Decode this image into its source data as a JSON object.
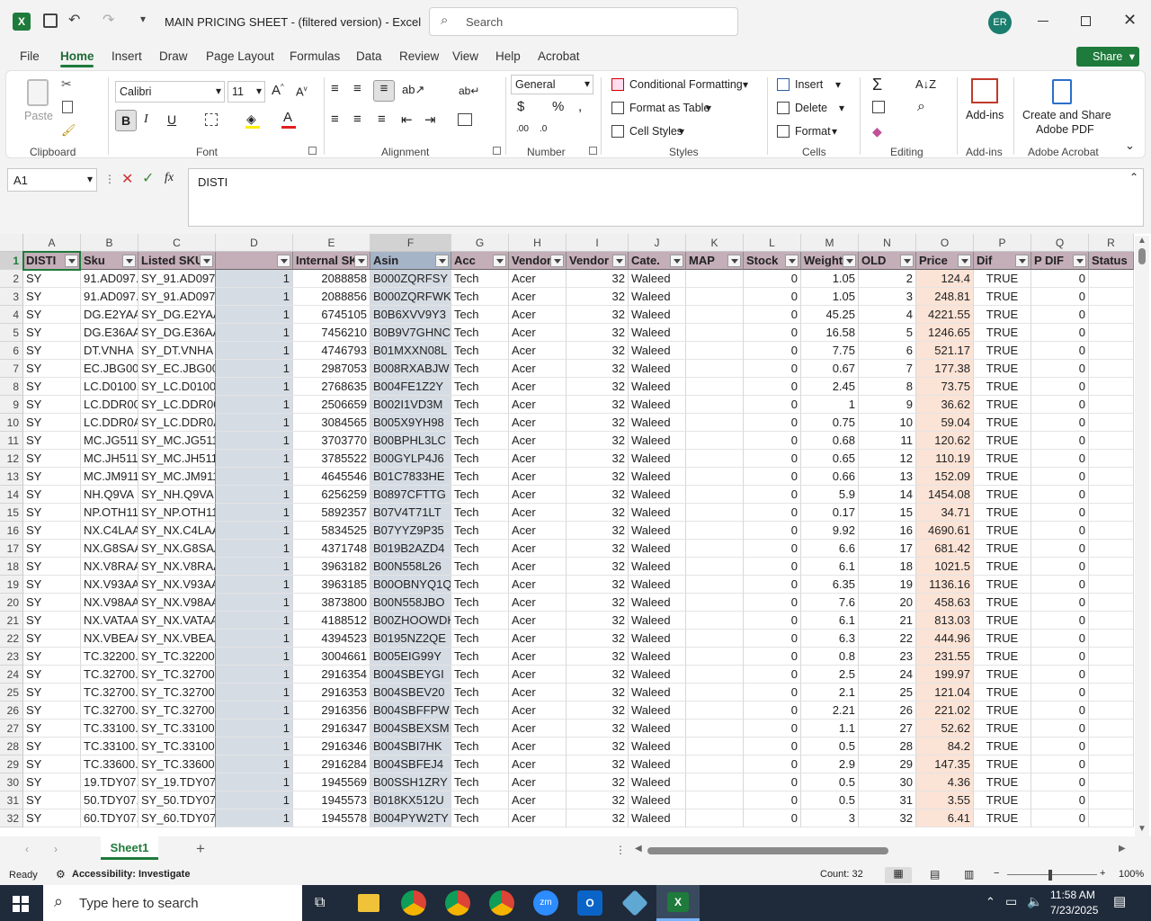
{
  "window": {
    "title": "MAIN PRICING SHEET - (filtered version)  -  Excel",
    "search_placeholder": "Search",
    "user_initials": "ER"
  },
  "ribbon_tabs": [
    "File",
    "Home",
    "Insert",
    "Draw",
    "Page Layout",
    "Formulas",
    "Data",
    "Review",
    "View",
    "Help",
    "Acrobat"
  ],
  "share_label": "Share",
  "ribbon": {
    "paste": "Paste",
    "font_name": "Calibri",
    "font_size": "11",
    "number_format": "General",
    "cond_format": "Conditional Formatting",
    "format_table": "Format as Table",
    "cell_styles": "Cell Styles",
    "insert": "Insert",
    "delete": "Delete",
    "format": "Format",
    "addins": "Add-ins",
    "create_share_1": "Create and Share",
    "create_share_2": "Adobe PDF",
    "groups": {
      "clipboard": "Clipboard",
      "font": "Font",
      "alignment": "Alignment",
      "number": "Number",
      "styles": "Styles",
      "cells": "Cells",
      "editing": "Editing",
      "addins": "Add-ins",
      "acrobat": "Adobe Acrobat"
    }
  },
  "formula_bar": {
    "name_box": "A1",
    "fx": "fx",
    "content": "DISTI"
  },
  "columns": [
    "A",
    "B",
    "C",
    "D",
    "E",
    "F",
    "G",
    "H",
    "I",
    "J",
    "K",
    "L",
    "M",
    "N",
    "O",
    "P",
    "Q",
    "R"
  ],
  "headers": [
    "DISTI",
    "Sku",
    "Listed SKU",
    "",
    "Internal SK",
    "Asin",
    "Acc",
    "Vendor",
    "Vendor",
    "Cate.",
    "MAP",
    "Stock",
    "Weight",
    "OLD",
    "Price",
    "Dif",
    "P DIF",
    "Status"
  ],
  "rows": [
    {
      "n": "2",
      "b": "91.AD097.",
      "c": "SY_91.AD097.",
      "e": "2088858",
      "f": "B000ZQRFSY",
      "m": "1.05",
      "o": "124.4"
    },
    {
      "n": "3",
      "b": "91.AD097.",
      "c": "SY_91.AD097.",
      "e": "2088856",
      "f": "B000ZQRFWK",
      "m": "1.05",
      "o": "248.81"
    },
    {
      "n": "4",
      "b": "DG.E2YAA",
      "c": "SY_DG.E2YAA",
      "e": "6745105",
      "f": "B0B6XVV9Y3",
      "m": "45.25",
      "o": "4221.55"
    },
    {
      "n": "5",
      "b": "DG.E36AA",
      "c": "SY_DG.E36AA",
      "e": "7456210",
      "f": "B0B9V7GHNC",
      "m": "16.58",
      "o": "1246.65"
    },
    {
      "n": "6",
      "b": "DT.VNHA",
      "c": "SY_DT.VNHA",
      "e": "4746793",
      "f": "B01MXXN08L",
      "m": "7.75",
      "o": "521.17"
    },
    {
      "n": "7",
      "b": "EC.JBG00.",
      "c": "SY_EC.JBG00.",
      "e": "2987053",
      "f": "B008RXABJW",
      "m": "0.67",
      "o": "177.38"
    },
    {
      "n": "8",
      "b": "LC.D0100.",
      "c": "SY_LC.D0100.",
      "e": "2768635",
      "f": "B004FE1Z2Y",
      "m": "2.45",
      "o": "73.75"
    },
    {
      "n": "9",
      "b": "LC.DDR00.",
      "c": "SY_LC.DDR00.",
      "e": "2506659",
      "f": "B002I1VD3M",
      "m": "1",
      "o": "36.62"
    },
    {
      "n": "10",
      "b": "LC.DDR0A",
      "c": "SY_LC.DDR0A",
      "e": "3084565",
      "f": "B005X9YH98",
      "m": "0.75",
      "o": "59.04"
    },
    {
      "n": "11",
      "b": "MC.JG511",
      "c": "SY_MC.JG511.",
      "e": "3703770",
      "f": "B00BPHL3LC",
      "m": "0.68",
      "o": "120.62"
    },
    {
      "n": "12",
      "b": "MC.JH511",
      "c": "SY_MC.JH511.",
      "e": "3785522",
      "f": "B00GYLP4J6",
      "m": "0.65",
      "o": "110.19"
    },
    {
      "n": "13",
      "b": "MC.JM911",
      "c": "SY_MC.JM911",
      "e": "4645546",
      "f": "B01C7833HE",
      "m": "0.66",
      "o": "152.09"
    },
    {
      "n": "14",
      "b": "NH.Q9VA",
      "c": "SY_NH.Q9VA",
      "e": "6256259",
      "f": "B0897CFTTG",
      "m": "5.9",
      "o": "1454.08"
    },
    {
      "n": "15",
      "b": "NP.OTH11",
      "c": "SY_NP.OTH11",
      "e": "5892357",
      "f": "B07V4T71LT",
      "m": "0.17",
      "o": "34.71"
    },
    {
      "n": "16",
      "b": "NX.C4LAA",
      "c": "SY_NX.C4LAA",
      "e": "5834525",
      "f": "B07YYZ9P35",
      "m": "9.92",
      "o": "4690.61"
    },
    {
      "n": "17",
      "b": "NX.G8SAA",
      "c": "SY_NX.G8SAA",
      "e": "4371748",
      "f": "B019B2AZD4",
      "m": "6.6",
      "o": "681.42"
    },
    {
      "n": "18",
      "b": "NX.V8RAA",
      "c": "SY_NX.V8RAA",
      "e": "3963182",
      "f": "B00N558L26",
      "m": "6.1",
      "o": "1021.5"
    },
    {
      "n": "19",
      "b": "NX.V93AA",
      "c": "SY_NX.V93AA",
      "e": "3963185",
      "f": "B00OBNYQ1Q",
      "m": "6.35",
      "o": "1136.16"
    },
    {
      "n": "20",
      "b": "NX.V98AA",
      "c": "SY_NX.V98AA",
      "e": "3873800",
      "f": "B00N558JBO",
      "m": "7.6",
      "o": "458.63"
    },
    {
      "n": "21",
      "b": "NX.VATAA",
      "c": "SY_NX.VATAA",
      "e": "4188512",
      "f": "B00ZHOOWDK",
      "m": "6.1",
      "o": "813.03"
    },
    {
      "n": "22",
      "b": "NX.VBEAA",
      "c": "SY_NX.VBEAA",
      "e": "4394523",
      "f": "B0195NZ2QE",
      "m": "6.3",
      "o": "444.96"
    },
    {
      "n": "23",
      "b": "TC.32200.",
      "c": "SY_TC.32200.",
      "e": "3004661",
      "f": "B005EIG99Y",
      "m": "0.8",
      "o": "231.55"
    },
    {
      "n": "24",
      "b": "TC.32700.",
      "c": "SY_TC.32700.",
      "e": "2916354",
      "f": "B004SBEYGI",
      "m": "2.5",
      "o": "199.97"
    },
    {
      "n": "25",
      "b": "TC.32700.",
      "c": "SY_TC.32700.",
      "e": "2916353",
      "f": "B004SBEV20",
      "m": "2.1",
      "o": "121.04"
    },
    {
      "n": "26",
      "b": "TC.32700.",
      "c": "SY_TC.32700.",
      "e": "2916356",
      "f": "B004SBFFPW",
      "m": "2.21",
      "o": "221.02"
    },
    {
      "n": "27",
      "b": "TC.33100.",
      "c": "SY_TC.33100.",
      "e": "2916347",
      "f": "B004SBEXSM",
      "m": "1.1",
      "o": "52.62"
    },
    {
      "n": "28",
      "b": "TC.33100.",
      "c": "SY_TC.33100.",
      "e": "2916346",
      "f": "B004SBI7HK",
      "m": "0.5",
      "o": "84.2"
    },
    {
      "n": "29",
      "b": "TC.33600.",
      "c": "SY_TC.33600.",
      "e": "2916284",
      "f": "B004SBFEJ4",
      "m": "2.9",
      "o": "147.35"
    },
    {
      "n": "30",
      "b": "19.TDY07.",
      "c": "SY_19.TDY07.",
      "e": "1945569",
      "f": "B00SSH1ZRY",
      "m": "0.5",
      "o": "4.36"
    },
    {
      "n": "31",
      "b": "50.TDY07.",
      "c": "SY_50.TDY07.",
      "e": "1945573",
      "f": "B018KX512U",
      "m": "0.5",
      "o": "3.55"
    },
    {
      "n": "32",
      "b": "60.TDY07.",
      "c": "SY_60.TDY07.",
      "e": "1945578",
      "f": "B004PYW2TY",
      "m": "3",
      "o": "6.41"
    }
  ],
  "row_constants": {
    "a": "SY",
    "d": "1",
    "g": "Tech",
    "h": "Acer",
    "i": "32",
    "j": "Waleed",
    "l": "0",
    "p": "TRUE",
    "q": "0"
  },
  "sheet_tab": "Sheet1",
  "status": {
    "ready": "Ready",
    "accessibility": "Accessibility: Investigate",
    "count": "Count: 32",
    "zoom": "100%"
  },
  "taskbar": {
    "search_placeholder": "Type here to search",
    "time": "11:58 AM",
    "date": "7/23/2025"
  },
  "colors": {
    "header_fill": "#c4aeb8",
    "price_fill": "#fbe3d6",
    "sel_col": "#d6dce4",
    "excel_green": "#1e7b3b"
  }
}
